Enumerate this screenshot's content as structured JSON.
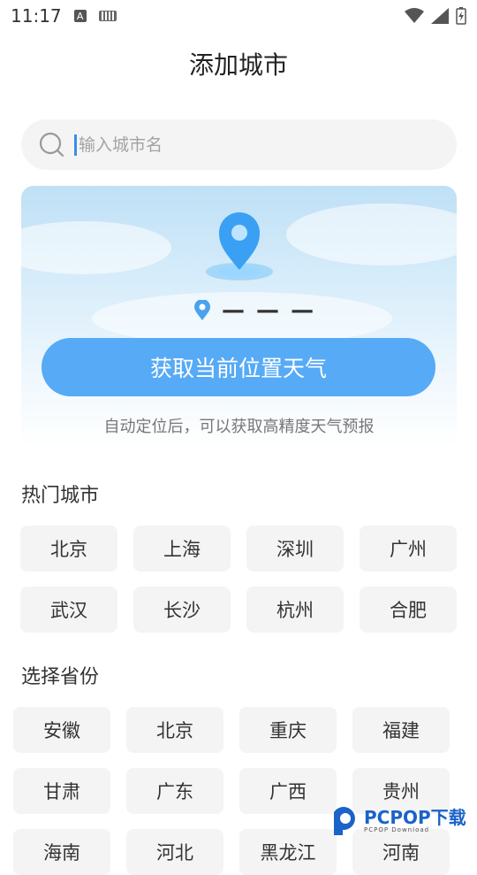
{
  "status_bar": {
    "time": "11:17",
    "a_icon": "A"
  },
  "page_title": "添加城市",
  "search": {
    "placeholder": "输入城市名"
  },
  "location_card": {
    "placeholder": "— — —",
    "button_label": "获取当前位置天气",
    "hint": "自动定位后，可以获取高精度天气预报"
  },
  "hot_cities": {
    "title": "热门城市",
    "items": [
      "北京",
      "上海",
      "深圳",
      "广州",
      "武汉",
      "长沙",
      "杭州",
      "合肥"
    ]
  },
  "provinces": {
    "title": "选择省份",
    "items": [
      "安徽",
      "北京",
      "重庆",
      "福建",
      "甘肃",
      "广东",
      "广西",
      "贵州",
      "海南",
      "河北",
      "黑龙江",
      "河南"
    ]
  },
  "watermark": {
    "name": "PCPOP下载",
    "sub": "PCPOP Download"
  },
  "colors": {
    "accent": "#56aaf6",
    "chip_bg": "#f4f4f4",
    "text": "#333333"
  }
}
